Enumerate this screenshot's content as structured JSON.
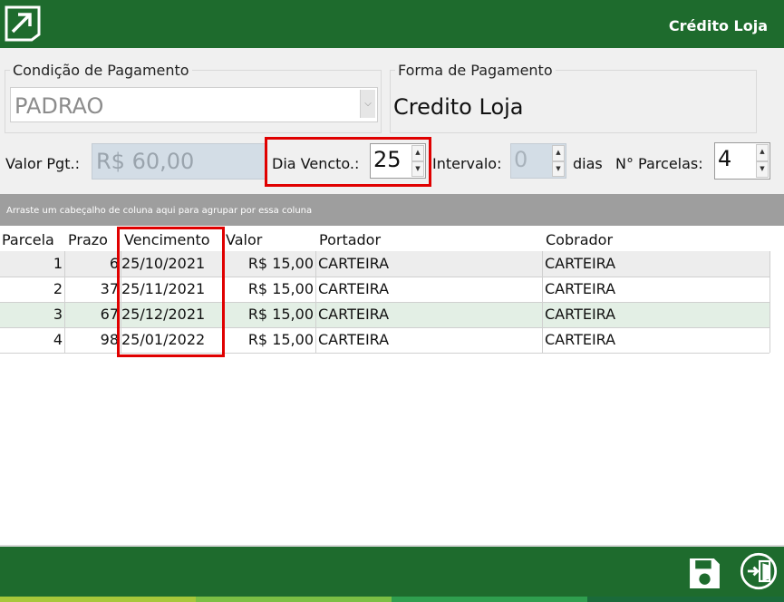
{
  "header": {
    "title": "Crédito Loja"
  },
  "condicao": {
    "legend": "Condição de Pagamento",
    "value": "PADRAO"
  },
  "forma": {
    "legend": "Forma de Pagamento",
    "value": "Credito Loja"
  },
  "fields": {
    "valor_label": "Valor Pgt.:",
    "valor_value": "R$ 60,00",
    "dia_label": "Dia Vencto.:",
    "dia_value": "25",
    "intervalo_label": "Intervalo:",
    "intervalo_value": "0",
    "dias_label": "dias",
    "parcelas_label": "N° Parcelas:",
    "parcelas_value": "4"
  },
  "grid": {
    "group_hint": "Arraste um cabeçalho de coluna aqui para agrupar por essa coluna",
    "columns": [
      "Parcela",
      "Prazo",
      "Vencimento",
      "Valor",
      "Portador",
      "Cobrador"
    ],
    "rows": [
      [
        "1",
        "6",
        "25/10/2021",
        "R$ 15,00",
        "CARTEIRA",
        "CARTEIRA"
      ],
      [
        "2",
        "37",
        "25/11/2021",
        "R$ 15,00",
        "CARTEIRA",
        "CARTEIRA"
      ],
      [
        "3",
        "67",
        "25/12/2021",
        "R$ 15,00",
        "CARTEIRA",
        "CARTEIRA"
      ],
      [
        "4",
        "98",
        "25/01/2022",
        "R$ 15,00",
        "CARTEIRA",
        "CARTEIRA"
      ]
    ]
  },
  "colors": {
    "header_green": "#1e6b2d",
    "highlight_red": "#e00000",
    "alt_row": "#e3efe5"
  },
  "footer": {
    "save_icon": "floppy-disk-icon",
    "exit_icon": "exit-door-icon"
  }
}
